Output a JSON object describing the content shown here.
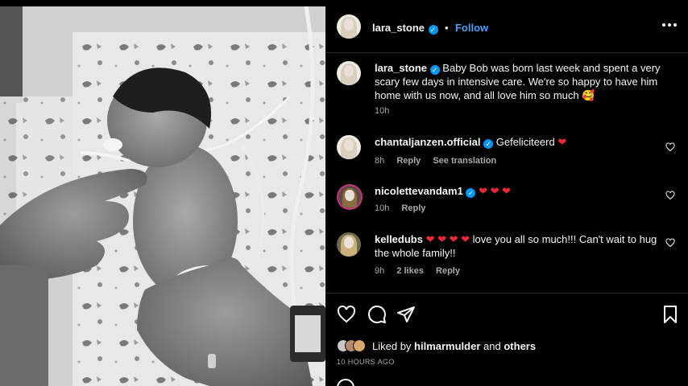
{
  "post": {
    "author": "lara_stone",
    "follow_label": "Follow",
    "separator": "•",
    "caption": "Baby Bob was born last week and spent a very scary few days in intensive care. We're so happy to have him home with us now, and all love him so much",
    "caption_emoji": "🥰",
    "caption_time": "10h"
  },
  "comments": [
    {
      "user": "chantaljanzen.official",
      "verified": true,
      "text": "Gefeliciteerd",
      "hearts": "❤",
      "time": "8h",
      "reply_label": "Reply",
      "extra_label": "See translation"
    },
    {
      "user": "nicolettevandam1",
      "verified": true,
      "text": "",
      "hearts": "❤ ❤ ❤",
      "time": "10h",
      "reply_label": "Reply"
    },
    {
      "user": "kelledubs",
      "verified": false,
      "hearts": "❤ ❤ ❤ ❤",
      "text": "love you all so much!!! Can't wait to hug the whole family!!",
      "time": "9h",
      "likes_label": "2 likes",
      "reply_label": "Reply"
    }
  ],
  "likes": {
    "prefix": "Liked by",
    "user": "hilmarmulder",
    "middle": "and",
    "suffix": "others"
  },
  "timestamp": "10 HOURS AGO",
  "colors": {
    "background": "#000000",
    "text": "#f5f5f5",
    "muted": "#a8a8a8",
    "accent": "#4ca0f5",
    "verified": "#0095f6",
    "heart": "#ed2939"
  },
  "icons": [
    "more-icon",
    "verified-icon",
    "heart-outline-icon",
    "comment-icon",
    "share-icon",
    "bookmark-icon",
    "emoji-icon"
  ]
}
